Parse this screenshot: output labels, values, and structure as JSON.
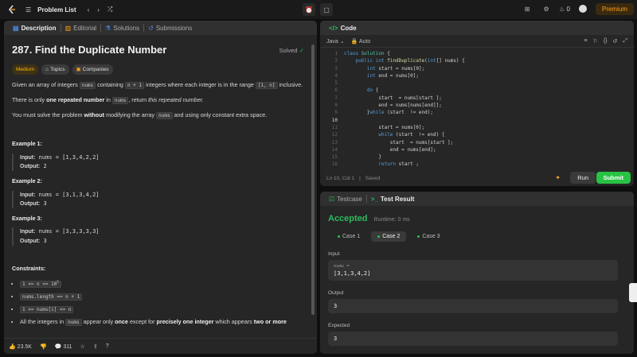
{
  "topbar": {
    "title": "Problem List",
    "premium": "Premium",
    "streak": "0"
  },
  "left_tabs": {
    "description": "Description",
    "editorial": "Editorial",
    "solutions": "Solutions",
    "submissions": "Submissions"
  },
  "problem": {
    "title": "287. Find the Duplicate Number",
    "solved": "Solved",
    "difficulty": "Medium",
    "topics": "Topics",
    "companies": "Companies",
    "p1a": "Given an array of integers",
    "p1_code1": "nums",
    "p1b": "containing",
    "p1_code2": "n + 1",
    "p1c": "integers where each integer is in the range",
    "p1_code3": "[1, n]",
    "p1d": "inclusive.",
    "p2a": "There is only",
    "p2_bold": "one repeated number",
    "p2b": "in",
    "p2_code": "nums",
    "p2c": ", return",
    "p2_it": "this repeated number.",
    "p3a": "You must solve the problem",
    "p3_bold": "without",
    "p3b": "modifying the array",
    "p3_code": "nums",
    "p3c": "and using only constant extra space.",
    "ex1_title": "Example 1:",
    "ex1_in": "nums = [1,3,4,2,2]",
    "ex1_out": "2",
    "ex2_title": "Example 2:",
    "ex2_in": "nums = [3,1,3,4,2]",
    "ex2_out": "3",
    "ex3_title": "Example 3:",
    "ex3_in": "nums = [3,3,3,3,3]",
    "ex3_out": "3",
    "input_label": "Input:",
    "output_label": "Output:",
    "constraints": "Constraints:",
    "c1": "1 <= n <= 10",
    "c1_exp": "5",
    "c2": "nums.length == n + 1",
    "c3": "1 <= nums[i] <= n",
    "c4a": "All the integers in",
    "c4_code": "nums",
    "c4b": "appear only",
    "c4_bold1": "once",
    "c4c": "except for",
    "c4_bold2": "precisely one integer",
    "c4d": "which appears",
    "c4_bold3": "two or more"
  },
  "left_footer": {
    "likes": "23.5K",
    "comments": "311"
  },
  "code_panel": {
    "title": "Code",
    "lang": "Java",
    "auto": "Auto",
    "status": "Ln 10, Col 1",
    "saved": "Saved",
    "run": "Run",
    "submit": "Submit"
  },
  "result_panel": {
    "testcase": "Testcase",
    "test_result": "Test Result",
    "accepted": "Accepted",
    "runtime": "Runtime: 0 ms",
    "case1": "Case 1",
    "case2": "Case 2",
    "case3": "Case 3",
    "input_label": "Input",
    "input_var": "nums =",
    "input_val": "[3,1,3,4,2]",
    "output_label": "Output",
    "output_val": "3",
    "expected_label": "Expected",
    "expected_val": "3"
  },
  "colors": {
    "accent": "#ffa116",
    "accepted": "#2cbb5d",
    "submit": "#28c244"
  }
}
